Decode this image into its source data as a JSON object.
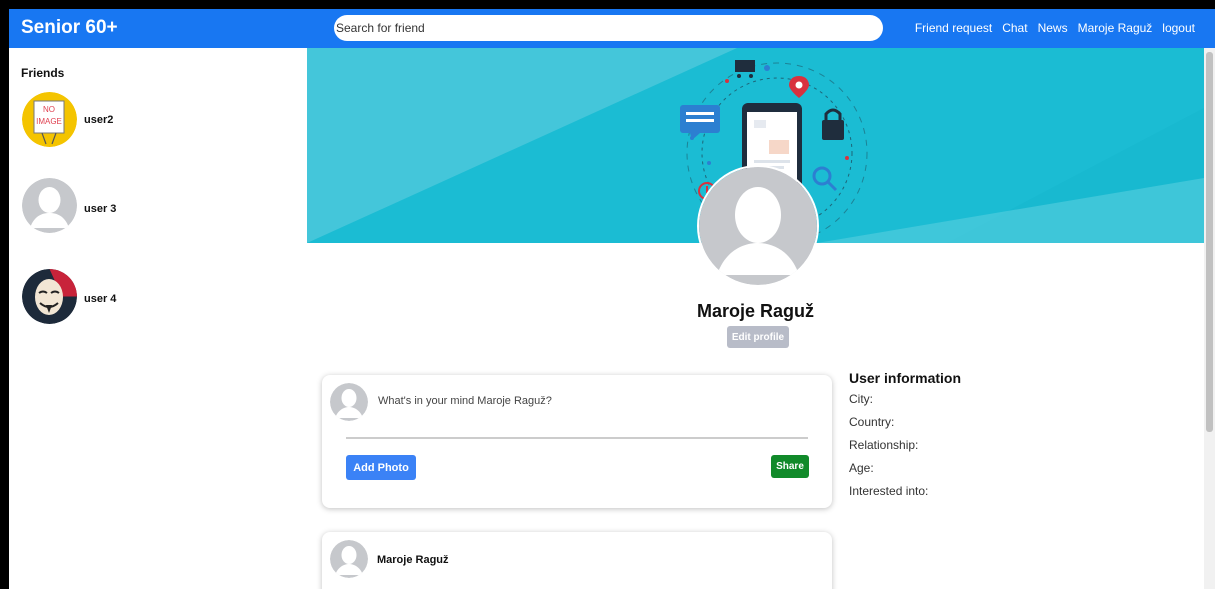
{
  "header": {
    "brand": "Senior 60+",
    "search_placeholder": "Search for friend",
    "nav": [
      "Friend request",
      "Chat",
      "News",
      "Maroje Raguž",
      "logout"
    ]
  },
  "sidebar": {
    "title": "Friends",
    "friends": [
      {
        "name": "user2",
        "avatar": "no-image"
      },
      {
        "name": "user 3",
        "avatar": "default-silhouette"
      },
      {
        "name": "user 4",
        "avatar": "mask-avatar"
      }
    ],
    "no_image_label": [
      "NO",
      "IMAGE"
    ]
  },
  "profile": {
    "name": "Maroje Raguž",
    "edit_label": "Edit profile"
  },
  "post_box": {
    "placeholder": "What's in your mind Maroje Raguž?",
    "add_photo_label": "Add Photo",
    "share_label": "Share"
  },
  "feed": {
    "author": "Maroje Raguž"
  },
  "user_info": {
    "title": "User information",
    "fields": [
      "City:",
      "Country:",
      "Relationship:",
      "Age:",
      "Interested into:"
    ]
  },
  "colors": {
    "header": "#1877f2",
    "cover": "#1bbcd3",
    "share": "#118a2a",
    "add_photo": "#3b82f6"
  }
}
